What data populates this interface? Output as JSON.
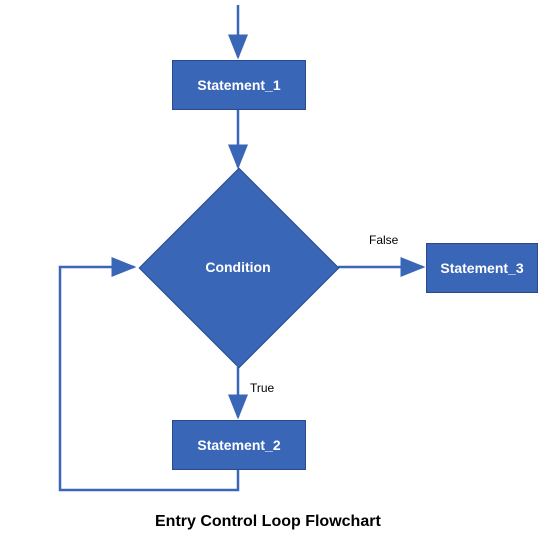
{
  "flowchart": {
    "title": "Entry Control Loop Flowchart",
    "nodes": {
      "statement_1": {
        "label": "Statement_1",
        "type": "process"
      },
      "condition": {
        "label": "Condition",
        "type": "decision"
      },
      "statement_2": {
        "label": "Statement_2",
        "type": "process"
      },
      "statement_3": {
        "label": "Statement_3",
        "type": "process"
      }
    },
    "edges": {
      "entry_to_s1": {
        "from": "entry",
        "to": "statement_1",
        "label": ""
      },
      "s1_to_cond": {
        "from": "statement_1",
        "to": "condition",
        "label": ""
      },
      "cond_to_s3": {
        "from": "condition",
        "to": "statement_3",
        "label": "False"
      },
      "cond_to_s2": {
        "from": "condition",
        "to": "statement_2",
        "label": "True"
      },
      "s2_to_cond": {
        "from": "statement_2",
        "to": "condition",
        "label": ""
      }
    },
    "colors": {
      "fill": "#3a66b7",
      "stroke": "#2a4a8a",
      "arrow": "#3a66b7"
    }
  }
}
